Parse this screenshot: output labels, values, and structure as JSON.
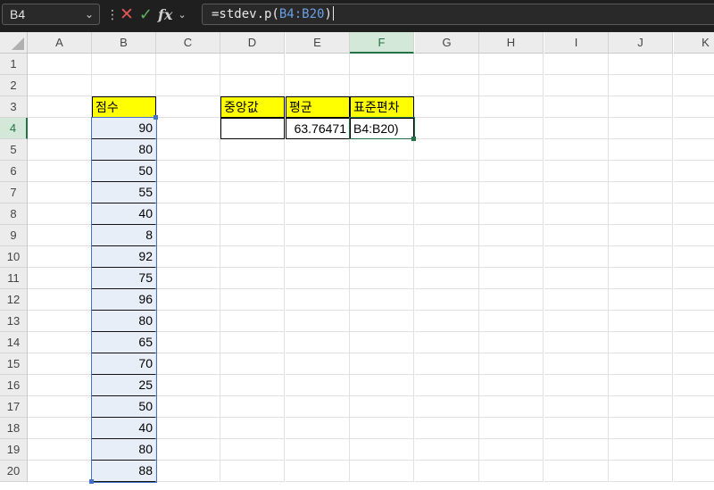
{
  "name_box": "B4",
  "formula": {
    "prefix": "=stdev.p(",
    "ref": "B4:B20",
    "suffix": ")"
  },
  "columns": [
    "A",
    "B",
    "C",
    "D",
    "E",
    "F",
    "G",
    "H",
    "I",
    "J",
    "K"
  ],
  "selected_column": "F",
  "rows": [
    "1",
    "2",
    "3",
    "4",
    "5",
    "6",
    "7",
    "8",
    "9",
    "10",
    "11",
    "12",
    "13",
    "14",
    "15",
    "16",
    "17",
    "18",
    "19",
    "20"
  ],
  "selected_row": "4",
  "score_header": "점수",
  "scores": [
    "90",
    "80",
    "50",
    "55",
    "40",
    "8",
    "92",
    "75",
    "96",
    "80",
    "65",
    "70",
    "25",
    "50",
    "40",
    "80",
    "88"
  ],
  "stats_headers": {
    "median": "중앙값",
    "mean": "평균",
    "stdev": "표준편차"
  },
  "stats_values": {
    "median": "",
    "mean": "63.76471",
    "stdev": "B4:B20)"
  },
  "colors": {
    "accent": "#217346",
    "range_ref": "#4472c4",
    "header_fill": "#ffff00"
  }
}
